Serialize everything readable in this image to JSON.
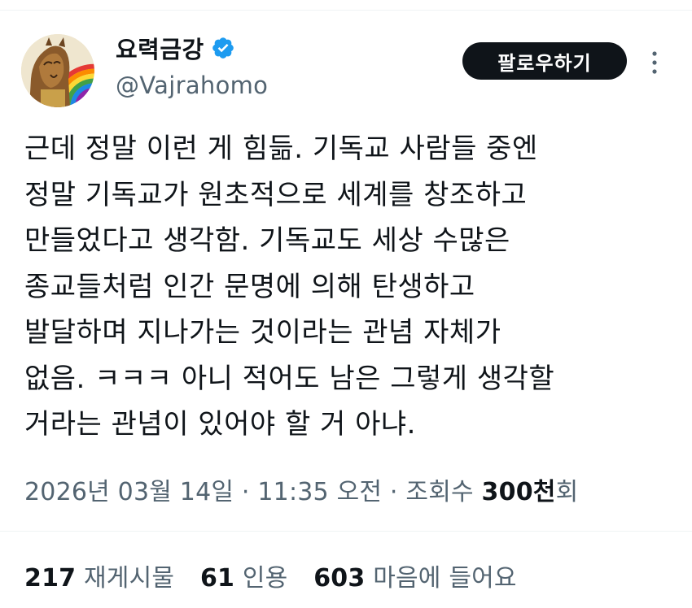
{
  "author": {
    "display_name": "요력금강",
    "handle": "@Vajrahomo",
    "verified": true,
    "avatar_icon": "avatar-lion-rainbow"
  },
  "follow_button": {
    "label": "팔로우하기"
  },
  "tweet": {
    "lines": [
      "근데 정말 이런 게 힘듦. 기독교 사람들 중엔",
      "정말 기독교가 원초적으로 세계를 창조하고",
      "만들었다고 생각함. 기독교도 세상 수많은",
      "종교들처럼 인간 문명에 의해 탄생하고",
      "발달하며 지나가는 것이라는 관념 자체가",
      "없음. ㅋㅋㅋ 아니 적어도 남은 그렇게 생각할",
      "거라는 관념이 있어야 할 거 아냐."
    ]
  },
  "meta": {
    "date": "2026년 03월 14일",
    "sep1": " · ",
    "time": "11:35 오전",
    "sep2": " · ",
    "views_label": "조회수 ",
    "views_count": "300천",
    "views_suffix": "회"
  },
  "stats": {
    "retweets_count": "217",
    "retweets_label": "재게시물",
    "quotes_count": "61",
    "quotes_label": "인용",
    "likes_count": "603",
    "likes_label": "마음에 들어요"
  },
  "colors": {
    "text_primary": "#0f1419",
    "text_secondary": "#536471",
    "verified_blue": "#1d9bf0",
    "button_bg": "#0f1419"
  }
}
